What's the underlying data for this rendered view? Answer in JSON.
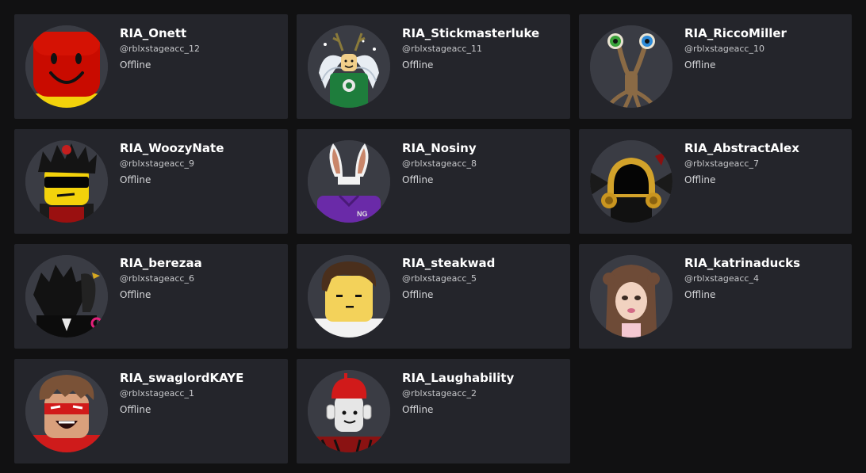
{
  "friends": [
    {
      "name": "RIA_Onett",
      "handle": "@rblxstageacc_12",
      "status": "Offline",
      "avatar_icon": "classic-smile-avatar-icon"
    },
    {
      "name": "RIA_Stickmasterluke",
      "handle": "@rblxstageacc_11",
      "status": "Offline",
      "avatar_icon": "winged-antler-avatar-icon"
    },
    {
      "name": "RIA_RiccoMiller",
      "handle": "@rblxstageacc_10",
      "status": "Offline",
      "avatar_icon": "eyestalk-creature-avatar-icon"
    },
    {
      "name": "RIA_WoozyNate",
      "handle": "@rblxstageacc_9",
      "status": "Offline",
      "avatar_icon": "sunglasses-spiky-hair-avatar-icon"
    },
    {
      "name": "RIA_Nosiny",
      "handle": "@rblxstageacc_8",
      "status": "Offline",
      "avatar_icon": "bunny-ears-avatar-icon"
    },
    {
      "name": "RIA_AbstractAlex",
      "handle": "@rblxstageacc_7",
      "status": "Offline",
      "avatar_icon": "golden-helmet-avatar-icon"
    },
    {
      "name": "RIA_berezaa",
      "handle": "@rblxstageacc_6",
      "status": "Offline",
      "avatar_icon": "dark-hair-bird-avatar-icon"
    },
    {
      "name": "RIA_steakwad",
      "handle": "@rblxstageacc_5",
      "status": "Offline",
      "avatar_icon": "brown-hair-frown-avatar-icon"
    },
    {
      "name": "RIA_katrinaducks",
      "handle": "@rblxstageacc_4",
      "status": "Offline",
      "avatar_icon": "long-hair-girl-avatar-icon"
    },
    {
      "name": "RIA_swaglordKAYE",
      "handle": "@rblxstageacc_1",
      "status": "Offline",
      "avatar_icon": "red-mask-avatar-icon"
    },
    {
      "name": "RIA_Laughability",
      "handle": "@rblxstageacc_2",
      "status": "Offline",
      "avatar_icon": "red-cap-headphones-avatar-icon"
    }
  ],
  "colors": {
    "background": "#111112",
    "card": "#24252b",
    "avatar_bg": "#3a3c44",
    "name": "#ffffff",
    "secondary_text": "#c6c7ca"
  }
}
